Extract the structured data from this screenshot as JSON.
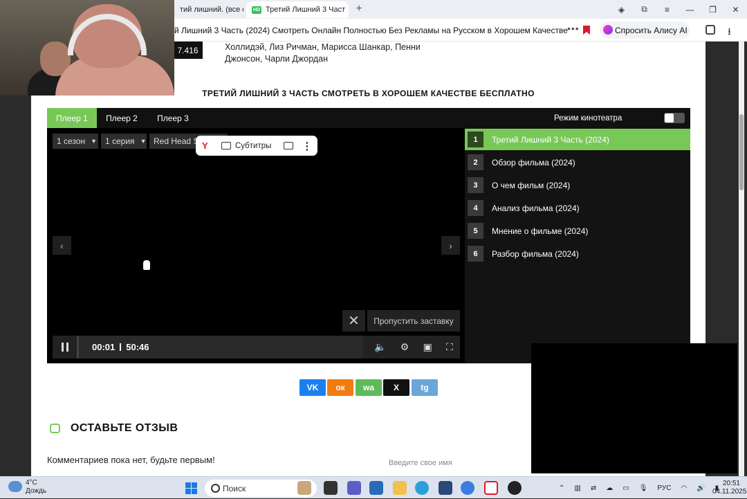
{
  "browser": {
    "tab_inactive_label": "тий лишний. (все сер",
    "tab_active_label": "Третий Лишний 3 Част",
    "tab_favicon": "HD",
    "address": "й Лишний 3 Часть (2024) Смотреть Онлайн Полностью Без Рекламы на Русском в Хорошем Качестве",
    "alice_label": "Спросить Алису AI"
  },
  "page": {
    "rating": "7.416",
    "cast_line1": "Холлидэй, Лиз Ричман, Марисса Шанкар, Пенни",
    "cast_line2": "Джонсон, Чарли Джордан",
    "section_title": "ТРЕТИЙ ЛИШНИЙ 3 ЧАСТЬ СМОТРЕТЬ В ХОРОШЕМ КАЧЕСТВЕ БЕСПЛАТНО"
  },
  "player": {
    "tabs": [
      "Плеер 1",
      "Плеер 2",
      "Плеер 3"
    ],
    "active_tab": 0,
    "cinema_mode_label": "Режим кинотеатра",
    "season": "1 сезон",
    "episode": "1 серия",
    "voiceover": "Red Head Sound",
    "yandex_subs_label": "Субтитры",
    "skip_intro_label": "Пропустить заставку",
    "time_current": "00:01",
    "time_total": "50:46",
    "playlist": [
      {
        "num": "1",
        "title": "Третий Лишний 3 Часть (2024)"
      },
      {
        "num": "2",
        "title": "Обзор фильма (2024)"
      },
      {
        "num": "3",
        "title": "О чем фильм (2024)"
      },
      {
        "num": "4",
        "title": "Анализ фильма (2024)"
      },
      {
        "num": "5",
        "title": "Мнение о фильме (2024)"
      },
      {
        "num": "6",
        "title": "Разбор фильма (2024)"
      }
    ]
  },
  "share": {
    "vk": "VK",
    "ok": "ок",
    "whatsapp": "wa",
    "x": "X",
    "telegram": "tg",
    "colors": {
      "vk": "#1b7ff0",
      "ok": "#f07c12",
      "whatsapp": "#5fba5a",
      "x": "#111111",
      "telegram": "#6ba6d8"
    }
  },
  "reviews": {
    "title": "ОСТАВЬТЕ ОТЗЫВ",
    "empty_text": "Комментариев пока нет, будьте первым!",
    "name_placeholder": "Введите свое имя"
  },
  "taskbar": {
    "temperature": "4°C",
    "weather": "Дождь",
    "search_label": "Поиск",
    "language": "РУС",
    "time": "20:51",
    "date": "04.11.2025"
  },
  "colors": {
    "accent_green": "#78c857"
  }
}
